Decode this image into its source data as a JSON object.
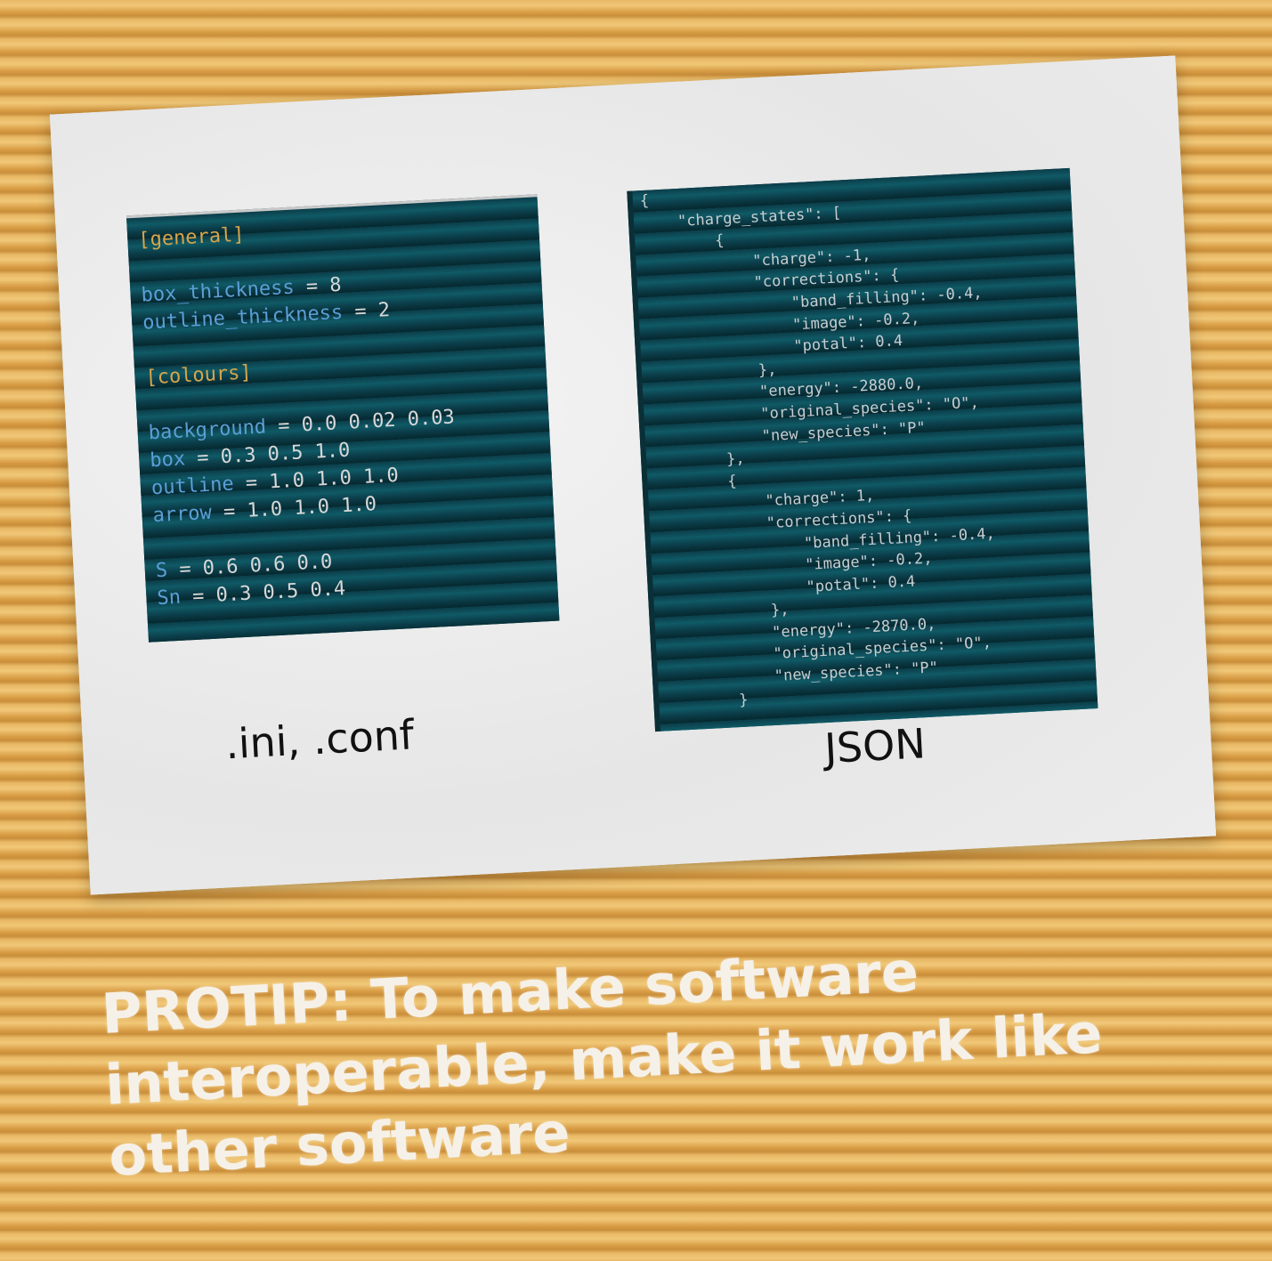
{
  "ini_panel": {
    "lines": [
      {
        "kind": "section",
        "text": "[general]"
      },
      {
        "kind": "blank",
        "text": ""
      },
      {
        "kind": "kv",
        "key": "box_thickness",
        "value": " = 8"
      },
      {
        "kind": "kv",
        "key": "outline_thickness",
        "value": " = 2"
      },
      {
        "kind": "blank",
        "text": ""
      },
      {
        "kind": "section",
        "text": "[colours]"
      },
      {
        "kind": "blank",
        "text": ""
      },
      {
        "kind": "kv",
        "key": "background",
        "value": " = 0.0 0.02 0.03"
      },
      {
        "kind": "kv",
        "key": "box",
        "value": " = 0.3 0.5 1.0"
      },
      {
        "kind": "kv",
        "key": "outline",
        "value": " = 1.0 1.0 1.0"
      },
      {
        "kind": "kv",
        "key": "arrow",
        "value": " = 1.0 1.0 1.0"
      },
      {
        "kind": "blank",
        "text": ""
      },
      {
        "kind": "kv",
        "key": "S",
        "value": " = 0.6 0.6 0.0"
      },
      {
        "kind": "kv",
        "key": "Sn",
        "value": " = 0.3 0.5 0.4"
      }
    ]
  },
  "json_panel": {
    "lines": [
      "{",
      "    \"charge_states\": [",
      "        {",
      "            \"charge\": -1,",
      "            \"corrections\": {",
      "                \"band_filling\": -0.4,",
      "                \"image\": -0.2,",
      "                \"potal\": 0.4",
      "            },",
      "            \"energy\": -2880.0,",
      "            \"original_species\": \"O\",",
      "            \"new_species\": \"P\"",
      "        },",
      "        {",
      "            \"charge\": 1,",
      "            \"corrections\": {",
      "                \"band_filling\": -0.4,",
      "                \"image\": -0.2,",
      "                \"potal\": 0.4",
      "            },",
      "            \"energy\": -2870.0,",
      "            \"original_species\": \"O\",",
      "            \"new_species\": \"P\"",
      "        }"
    ]
  },
  "captions": {
    "ini": ".ini, .conf",
    "json": "JSON"
  },
  "protip": {
    "text": "PROTIP: To make software interoperable, make it work like other software"
  },
  "colors": {
    "background": "#d9a24a",
    "card": "#ebebeb",
    "code_bg": "#0c4450",
    "section": "#d7a54a",
    "key": "#5b9fd6",
    "value": "#d8d8d8",
    "protip_text": "#f6f1e8"
  }
}
